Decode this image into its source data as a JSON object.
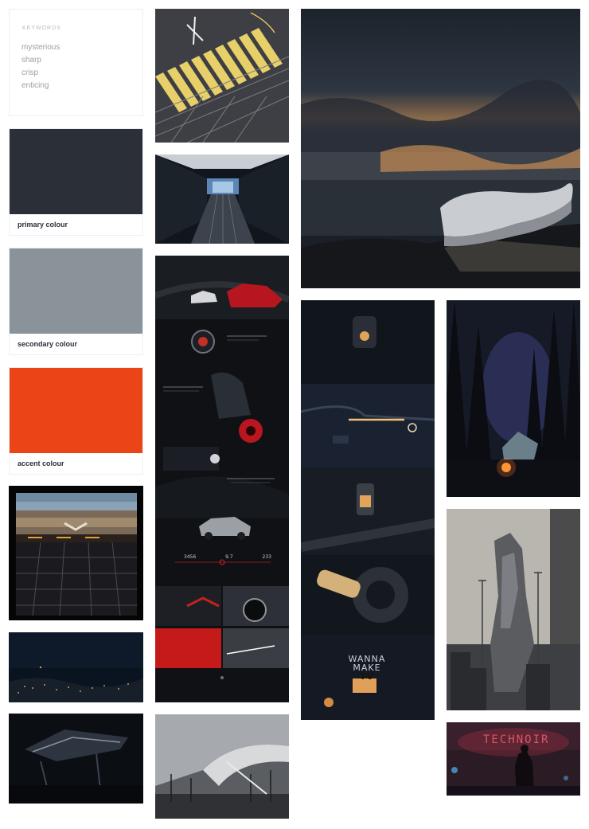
{
  "keywords": {
    "title": "KEYWORDS",
    "items": [
      "mysterious",
      "sharp",
      "crisp",
      "enticing"
    ]
  },
  "swatches": {
    "primary": {
      "label": "primary colour",
      "color": "#2b2f38"
    },
    "secondary": {
      "label": "secondary colour",
      "color": "#8a9399"
    },
    "accent": {
      "label": "accent colour",
      "color": "#ea4417"
    }
  },
  "images": {
    "stadium": "stadium-bleachers-image",
    "night_city": "night-city-aerial-image",
    "ship": "ship-dark-image",
    "runway": "runway-markings-image",
    "tunnel": "escalator-tunnel-image",
    "car_site": "car-website-mockup-image",
    "architecture": "concrete-architecture-image",
    "cliff_house": "cliff-house-image",
    "tv_site": "tv-design-mockup-image",
    "forest": "forest-camp-image",
    "city_tower": "dystopian-tower-image",
    "neon": "neon-sign-image"
  },
  "car_site": {
    "stats": [
      "3456",
      "9.7",
      "233"
    ]
  },
  "tv_site": {
    "line1": "WANNA",
    "line2": "MAKE",
    "line3": "TV"
  },
  "neon": {
    "text": "TECHNOIR"
  }
}
